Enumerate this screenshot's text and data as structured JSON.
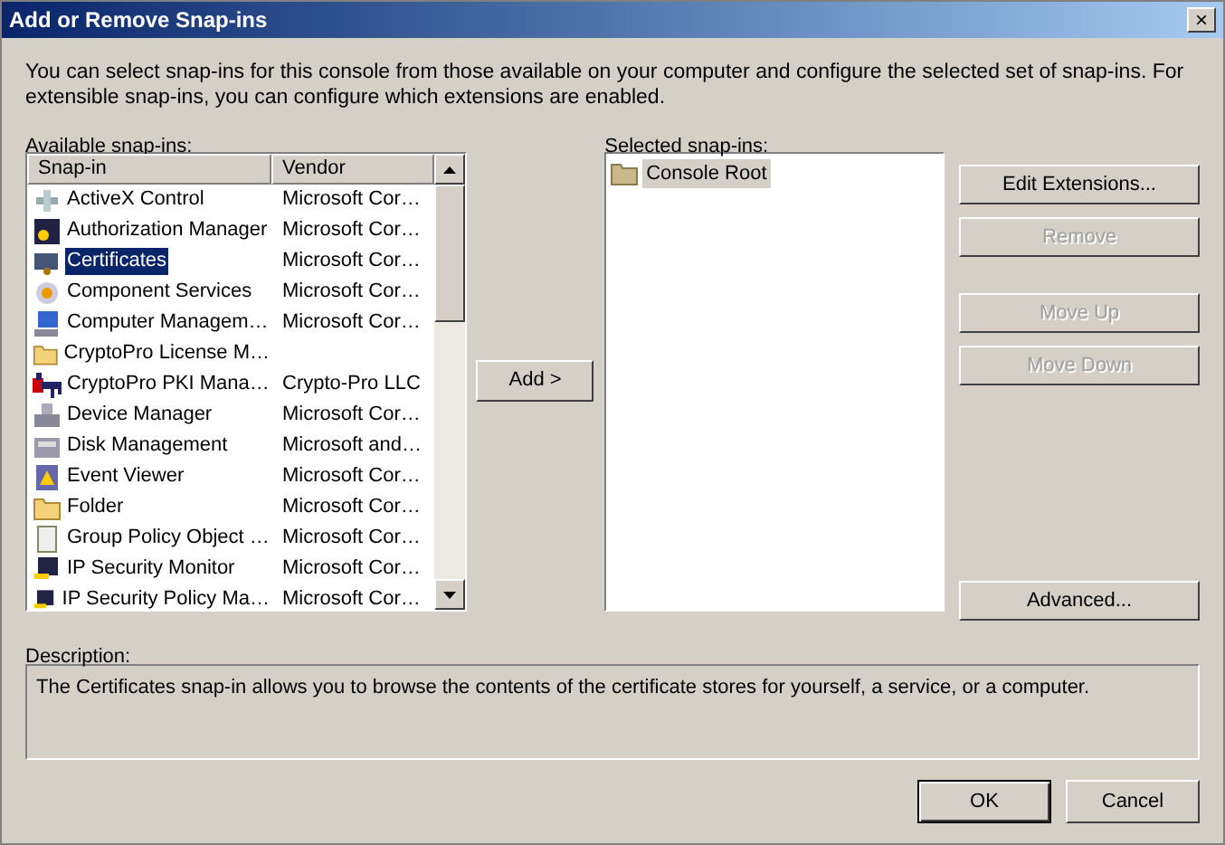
{
  "window": {
    "title": "Add or Remove Snap-ins",
    "close": "×"
  },
  "intro": "You can select snap-ins for this console from those available on your computer and configure the selected set of snap-ins. For extensible snap-ins, you can configure which extensions are enabled.",
  "available": {
    "label": "Available snap-ins:",
    "columns": [
      "Snap-in",
      "Vendor"
    ],
    "rows": [
      {
        "name": "ActiveX Control",
        "vendor": "Microsoft Cor…",
        "selected": false
      },
      {
        "name": "Authorization Manager",
        "vendor": "Microsoft Cor…",
        "selected": false
      },
      {
        "name": "Certificates",
        "vendor": "Microsoft Cor…",
        "selected": true
      },
      {
        "name": "Component Services",
        "vendor": "Microsoft Cor…",
        "selected": false
      },
      {
        "name": "Computer Managem…",
        "vendor": "Microsoft Cor…",
        "selected": false
      },
      {
        "name": "CryptoPro License M…",
        "vendor": "",
        "selected": false
      },
      {
        "name": "CryptoPro PKI Mana…",
        "vendor": "Crypto-Pro LLC",
        "selected": false
      },
      {
        "name": "Device Manager",
        "vendor": "Microsoft Cor…",
        "selected": false
      },
      {
        "name": "Disk Management",
        "vendor": "Microsoft and…",
        "selected": false
      },
      {
        "name": "Event Viewer",
        "vendor": "Microsoft Cor…",
        "selected": false
      },
      {
        "name": "Folder",
        "vendor": "Microsoft Cor…",
        "selected": false
      },
      {
        "name": "Group Policy Object …",
        "vendor": "Microsoft Cor…",
        "selected": false
      },
      {
        "name": "IP Security Monitor",
        "vendor": "Microsoft Cor…",
        "selected": false
      },
      {
        "name": "IP Security Policy Ma…",
        "vendor": "Microsoft Cor…",
        "selected": false
      }
    ]
  },
  "add_button": {
    "label": "Add >"
  },
  "selected_snapins": {
    "label": "Selected snap-ins:",
    "items": [
      {
        "name": "Console Root",
        "selected": true
      }
    ]
  },
  "side_buttons": [
    {
      "label": "Edit Extensions...",
      "disabled": false
    },
    {
      "label": "Remove",
      "disabled": true
    },
    {
      "label": "Move Up",
      "disabled": true
    },
    {
      "label": "Move Down",
      "disabled": true
    },
    {
      "label": "Advanced...",
      "disabled": false
    }
  ],
  "description": {
    "label": "Description:",
    "text": "The Certificates snap-in allows you to browse the contents of the certificate stores for yourself, a service, or a computer."
  },
  "footer_buttons": [
    {
      "label": "OK",
      "default": true
    },
    {
      "label": "Cancel",
      "default": false
    }
  ]
}
